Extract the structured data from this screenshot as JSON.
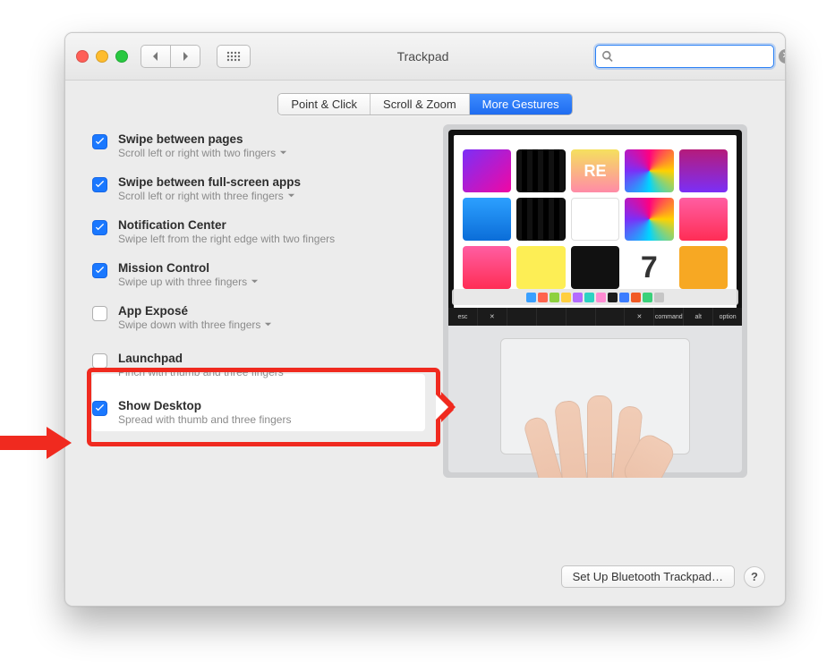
{
  "window": {
    "title": "Trackpad"
  },
  "search": {
    "placeholder": ""
  },
  "tabs": {
    "point_click": "Point & Click",
    "scroll_zoom": "Scroll & Zoom",
    "more_gestures": "More Gestures"
  },
  "options": {
    "swipe_pages": {
      "title": "Swipe between pages",
      "subtitle": "Scroll left or right with two fingers",
      "checked": true,
      "has_dropdown": true
    },
    "swipe_apps": {
      "title": "Swipe between full-screen apps",
      "subtitle": "Scroll left or right with three fingers",
      "checked": true,
      "has_dropdown": true
    },
    "notification_center": {
      "title": "Notification Center",
      "subtitle": "Swipe left from the right edge with two fingers",
      "checked": true,
      "has_dropdown": false
    },
    "mission_control": {
      "title": "Mission Control",
      "subtitle": "Swipe up with three fingers",
      "checked": true,
      "has_dropdown": true
    },
    "app_expose": {
      "title": "App Exposé",
      "subtitle": "Swipe down with three fingers",
      "checked": false,
      "has_dropdown": true
    },
    "launchpad": {
      "title": "Launchpad",
      "subtitle": "Pinch with thumb and three fingers",
      "checked": false,
      "has_dropdown": false
    },
    "show_desktop": {
      "title": "Show Desktop",
      "subtitle": "Spread with thumb and three fingers",
      "checked": true,
      "has_dropdown": false
    }
  },
  "touchbar_keys": [
    "esc",
    "✕",
    "",
    "",
    "",
    "",
    "✕",
    "command",
    "alt",
    "option"
  ],
  "footer": {
    "bluetooth": "Set Up Bluetooth Trackpad…",
    "help": "?"
  }
}
